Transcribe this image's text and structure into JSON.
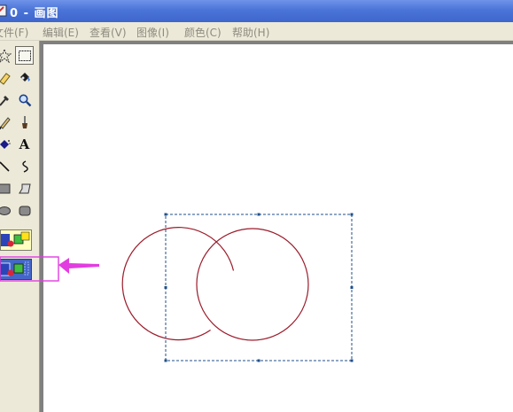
{
  "window": {
    "title": "0 - 画图"
  },
  "menu": [
    {
      "label": "文件(F)"
    },
    {
      "label": "编辑(E)"
    },
    {
      "label": "查看(V)"
    },
    {
      "label": "图像(I)"
    },
    {
      "label": "颜色(C)"
    },
    {
      "label": "帮助(H)"
    }
  ],
  "toolbox": {
    "tools": [
      {
        "name": "free-form-select",
        "icon": "star-select-icon"
      },
      {
        "name": "rectangle-select",
        "icon": "dotted-rect-select-icon",
        "selected": true
      },
      {
        "name": "eraser",
        "icon": "eraser-icon"
      },
      {
        "name": "fill-with-color",
        "icon": "paint-bucket-icon"
      },
      {
        "name": "pick-color",
        "icon": "eyedropper-icon"
      },
      {
        "name": "magnifier",
        "icon": "magnifier-icon"
      },
      {
        "name": "pencil",
        "icon": "pencil-icon"
      },
      {
        "name": "brush",
        "icon": "brush-icon"
      },
      {
        "name": "airbrush",
        "icon": "airbrush-icon"
      },
      {
        "name": "text",
        "icon": "text-icon",
        "glyph": "A"
      },
      {
        "name": "line",
        "icon": "line-icon"
      },
      {
        "name": "curve",
        "icon": "curve-icon"
      },
      {
        "name": "rectangle",
        "icon": "rectangle-icon"
      },
      {
        "name": "polygon",
        "icon": "polygon-icon"
      },
      {
        "name": "ellipse",
        "icon": "ellipse-icon"
      },
      {
        "name": "rounded-rectangle",
        "icon": "rounded-rectangle-icon"
      }
    ],
    "selection_modes": [
      {
        "name": "opaque",
        "icon": "opaque-selection-icon",
        "active": false
      },
      {
        "name": "transparent",
        "icon": "transparent-selection-icon",
        "active": true
      }
    ]
  },
  "canvas": {
    "drawing": {
      "shape": "two overlapping circles",
      "color": "#9b1b2a"
    },
    "selection": {
      "color": "#1f4f8a"
    }
  },
  "annotation": {
    "shape": "arrow",
    "color": "#e23de0"
  }
}
